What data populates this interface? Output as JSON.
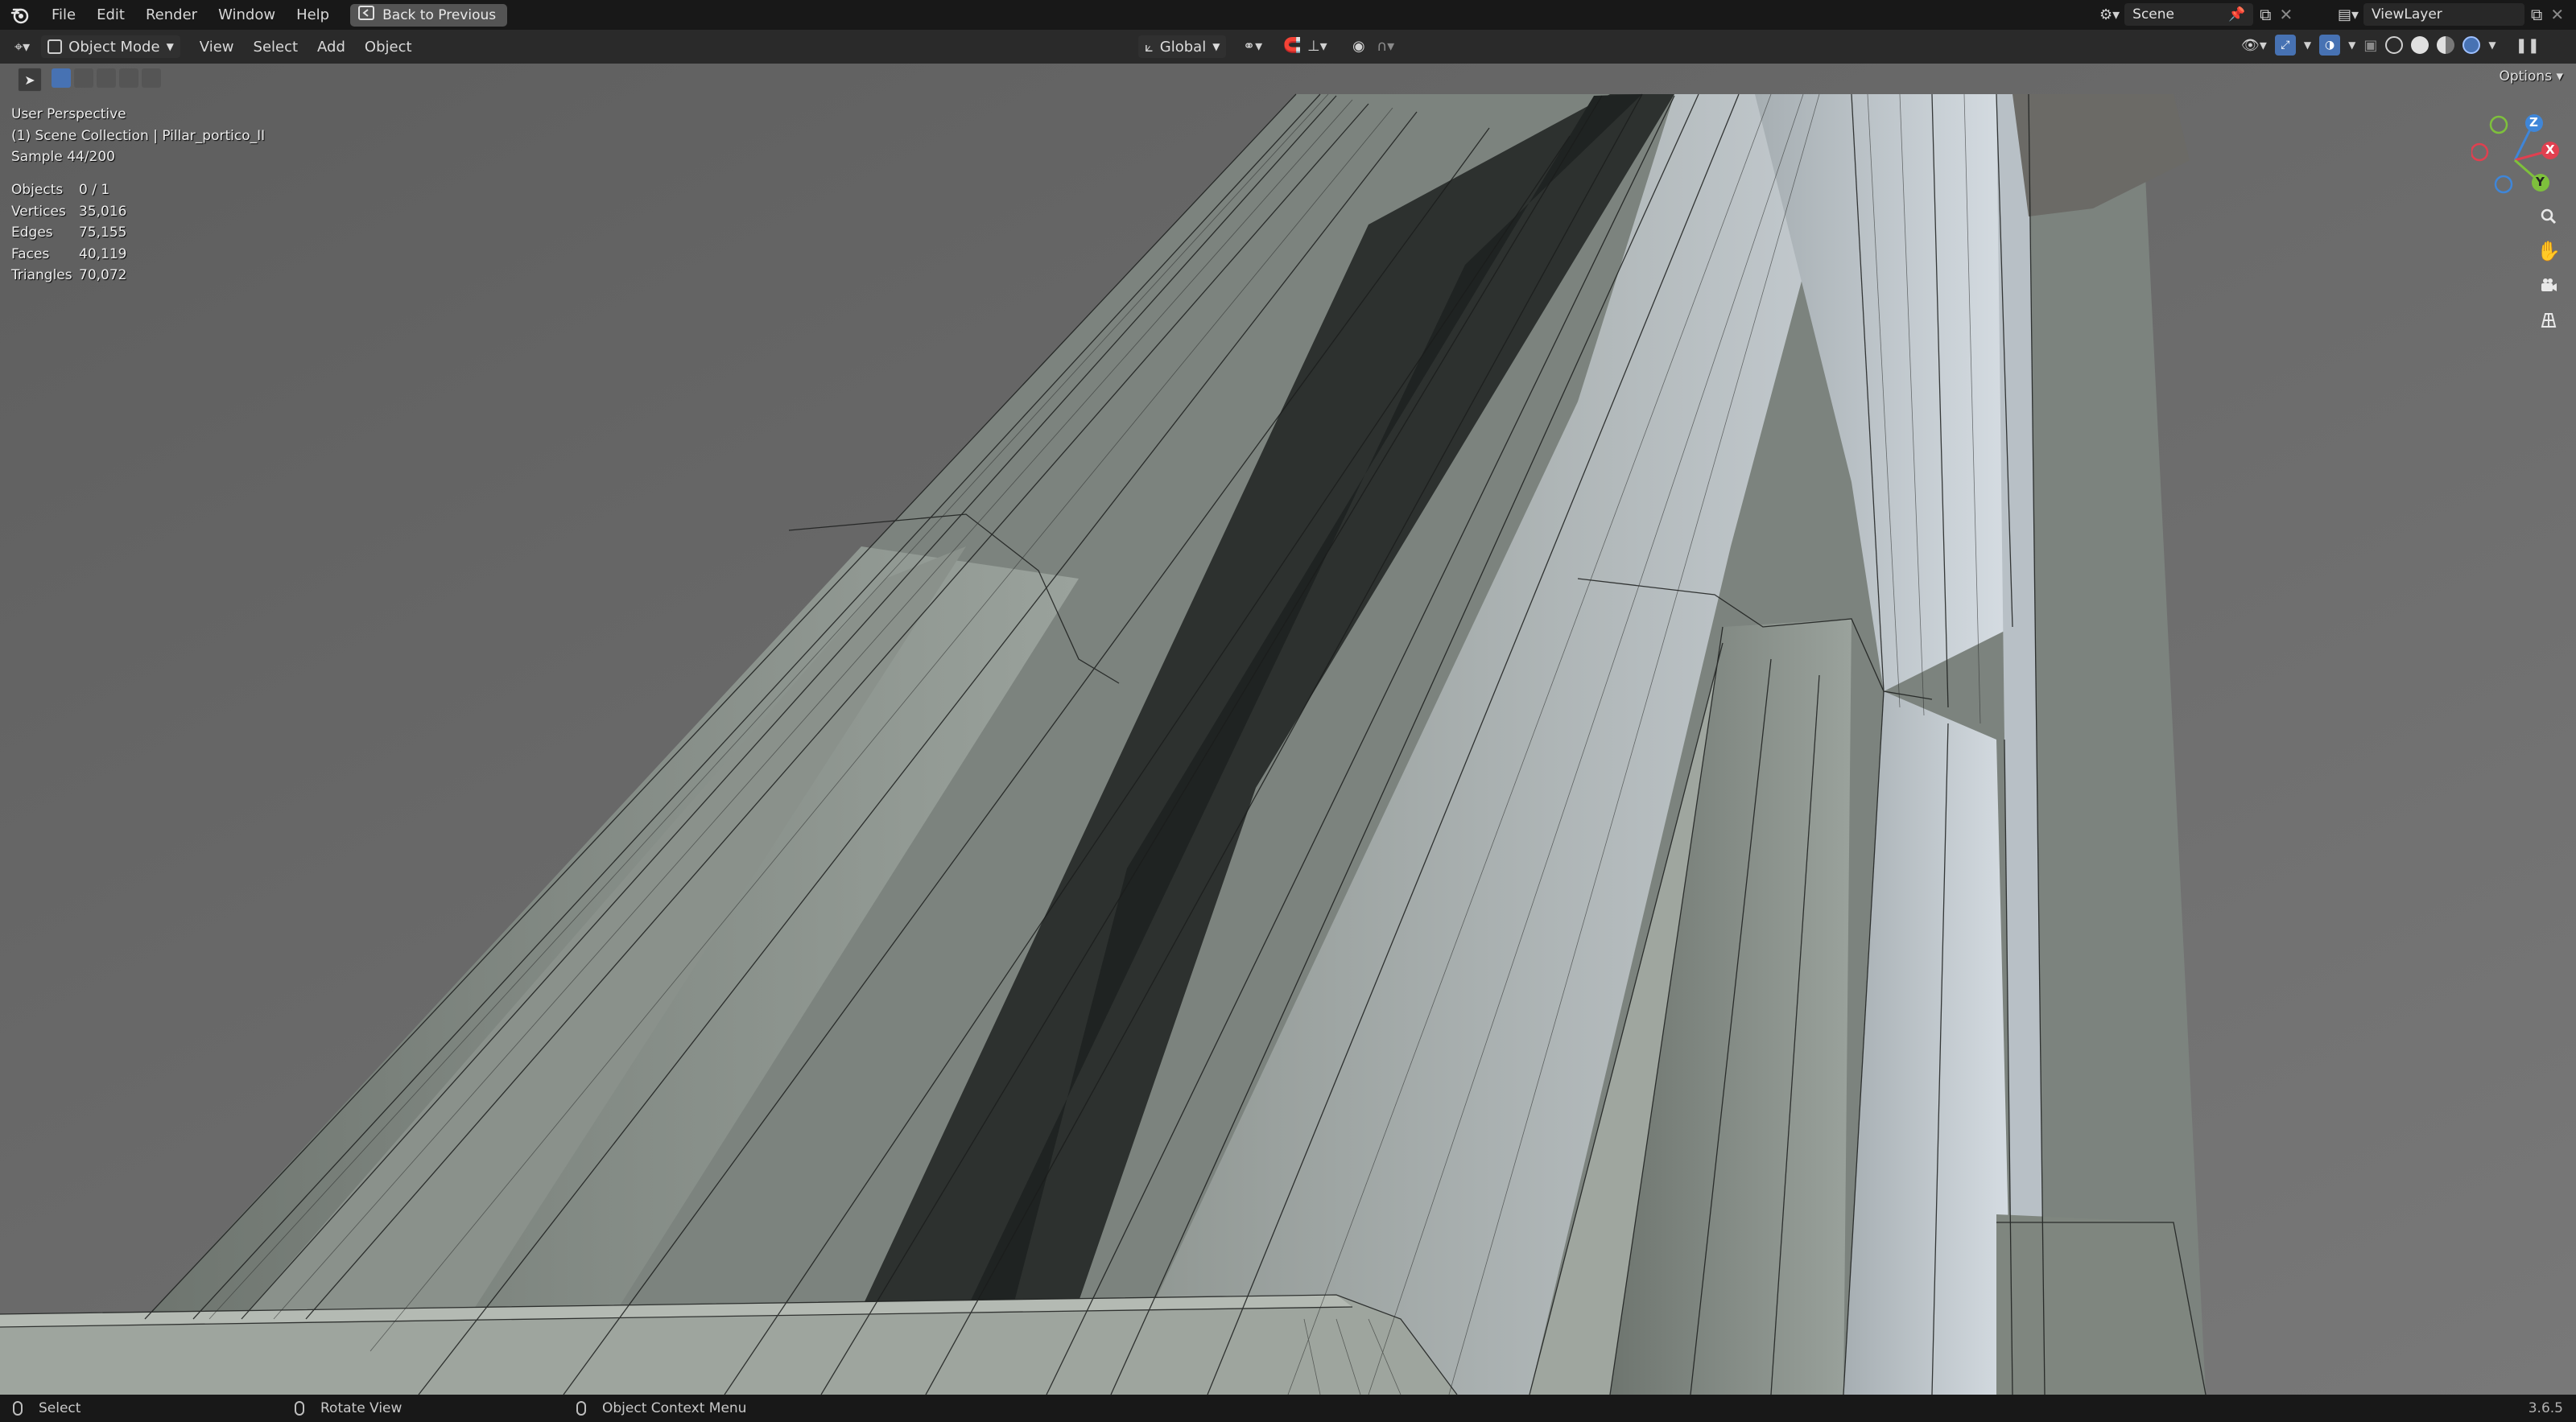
{
  "topbar": {
    "menus": [
      "File",
      "Edit",
      "Render",
      "Window",
      "Help"
    ],
    "back_button": "Back to Previous",
    "scene": "Scene",
    "view_layer": "ViewLayer"
  },
  "header": {
    "mode": "Object Mode",
    "menus": [
      "View",
      "Select",
      "Add",
      "Object"
    ],
    "orientation": "Global",
    "options": "Options"
  },
  "overlay": {
    "perspective": "User Perspective",
    "collection": "(1) Scene Collection | Pillar_portico_II",
    "sample": "Sample 44/200"
  },
  "stats": [
    {
      "label": "Objects",
      "value": "0 / 1"
    },
    {
      "label": "Vertices",
      "value": "35,016"
    },
    {
      "label": "Edges",
      "value": "75,155"
    },
    {
      "label": "Faces",
      "value": "40,119"
    },
    {
      "label": "Triangles",
      "value": "70,072"
    }
  ],
  "gizmo": {
    "x": "X",
    "y": "Y",
    "z": "Z"
  },
  "statusbar": {
    "select": "Select",
    "rotate": "Rotate View",
    "context": "Object Context Menu",
    "version": "3.6.5"
  },
  "colors": {
    "x_axis": "#e04050",
    "y_axis": "#7ec03c",
    "z_axis": "#3f86d8",
    "active_blue": "#4772b3"
  }
}
